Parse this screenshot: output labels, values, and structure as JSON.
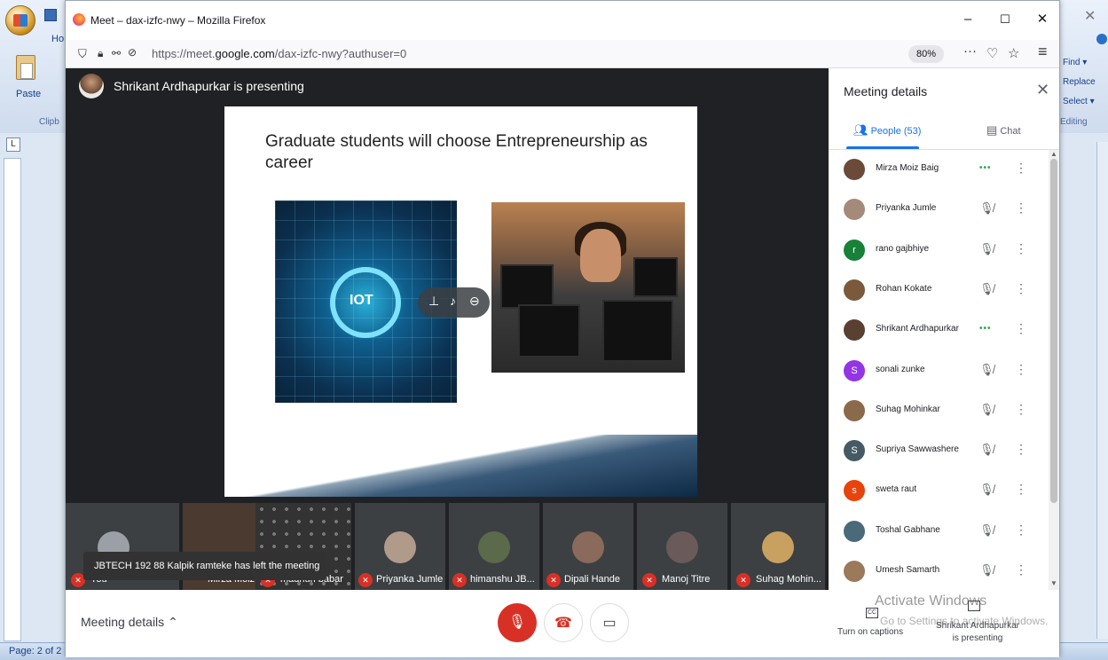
{
  "window": {
    "title": "Meet – dax-izfc-nwy – Mozilla Firefox",
    "min": "–",
    "max": "☐",
    "close": "✕"
  },
  "nav": {
    "url_prefix": "https://meet.",
    "url_domain": "google.com",
    "url_suffix": "/dax-izfc-nwy?authuser=0",
    "zoom": "80%",
    "more": "···",
    "pocket": "♡",
    "star": "☆",
    "menu": "≡"
  },
  "word": {
    "home_tab": "Ho",
    "paste": "Paste",
    "clipboard": "Clipb",
    "find": "Find ▾",
    "replace": "Replace",
    "select": "Select ▾",
    "editing": "Editing",
    "tab_marker": "L",
    "page_status": "Page: 2 of 2"
  },
  "meet": {
    "presenting_banner": "Shrikant Ardhapurkar is presenting",
    "slide_title": "Graduate students will choose Entrepreneurship as career",
    "slide_iot": "IOT",
    "toast": "JBTECH 192 88 Kalpik ramteke has left the meeting",
    "tiles": [
      {
        "name": "You"
      },
      {
        "name": "Mirza Moiz B..."
      },
      {
        "name": "madhuri babar"
      },
      {
        "name": "Priyanka Jumle"
      },
      {
        "name": "himanshu JB..."
      },
      {
        "name": "Dipali Hande"
      },
      {
        "name": "Manoj Titre"
      },
      {
        "name": "Suhag Mohin..."
      }
    ],
    "bottom": {
      "meeting_details": "Meeting details",
      "captions": "Turn on captions",
      "cc": "CC",
      "presenter": "Shrikant Ardhapurkar is presenting",
      "activate_title": "Activate Windows",
      "activate_sub": "Go to Settings to activate Windows."
    }
  },
  "panel": {
    "title": "Meeting details",
    "close": "✕",
    "people_tab": "People (53)",
    "chat_tab": "Chat",
    "people": [
      {
        "name": "Mirza Moiz Baig",
        "initial": "",
        "color": "#6b4a3a",
        "status": "talking"
      },
      {
        "name": "Priyanka Jumle",
        "initial": "",
        "color": "#a58a7a",
        "status": "muted"
      },
      {
        "name": "rano gajbhiye",
        "initial": "r",
        "color": "#188038",
        "status": "muted"
      },
      {
        "name": "Rohan Kokate",
        "initial": "",
        "color": "#7a5a3a",
        "status": "muted"
      },
      {
        "name": "Shrikant Ardhapurkar",
        "initial": "",
        "color": "#5a4030",
        "status": "talking"
      },
      {
        "name": "sonali zunke",
        "initial": "S",
        "color": "#9334e6",
        "status": "muted"
      },
      {
        "name": "Suhag Mohinkar",
        "initial": "",
        "color": "#8a6a4a",
        "status": "muted"
      },
      {
        "name": "Supriya Sawwashere",
        "initial": "S",
        "color": "#455a64",
        "status": "muted"
      },
      {
        "name": "sweta raut",
        "initial": "s",
        "color": "#e8430a",
        "status": "muted"
      },
      {
        "name": "Toshal Gabhane",
        "initial": "",
        "color": "#4a6a7a",
        "status": "muted"
      },
      {
        "name": "Umesh Samarth",
        "initial": "",
        "color": "#9a7a5a",
        "status": "muted"
      }
    ]
  },
  "colors": {
    "meet_dark": "#202124",
    "accent_blue": "#1a73e8",
    "mic_red": "#d93025",
    "talk_green": "#34a853"
  },
  "icons": {
    "mic_off": "mic-off-icon",
    "more_vert": "more-vert-icon",
    "people": "people-icon",
    "chat": "chat-icon",
    "end_call": "end-call-icon",
    "camera": "camera-icon"
  }
}
